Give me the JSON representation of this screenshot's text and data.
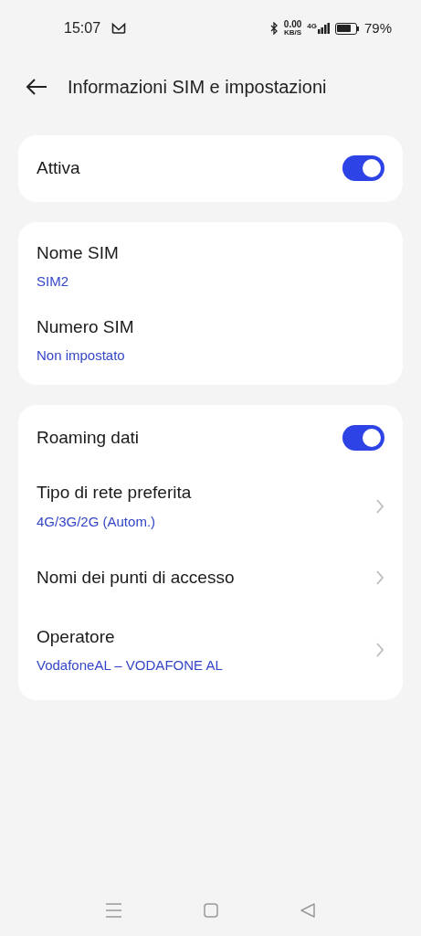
{
  "status_bar": {
    "time": "15:07",
    "speed_value": "0.00",
    "speed_unit": "KB/S",
    "network": "4G",
    "battery": "79%"
  },
  "header": {
    "title": "Informazioni SIM e impostazioni"
  },
  "cards": [
    {
      "rows": [
        {
          "kind": "toggle",
          "label": "Attiva",
          "on": true
        }
      ]
    },
    {
      "rows": [
        {
          "kind": "info",
          "label": "Nome SIM",
          "value": "SIM2"
        },
        {
          "kind": "info",
          "label": "Numero SIM",
          "value": "Non impostato"
        }
      ]
    },
    {
      "rows": [
        {
          "kind": "toggle",
          "label": "Roaming dati",
          "on": true
        },
        {
          "kind": "link",
          "label": "Tipo di rete preferita",
          "value": "4G/3G/2G (Autom.)"
        },
        {
          "kind": "link",
          "label": "Nomi dei punti di accesso"
        },
        {
          "kind": "link",
          "label": "Operatore",
          "value": "VodafoneAL – VODAFONE AL"
        }
      ]
    }
  ]
}
